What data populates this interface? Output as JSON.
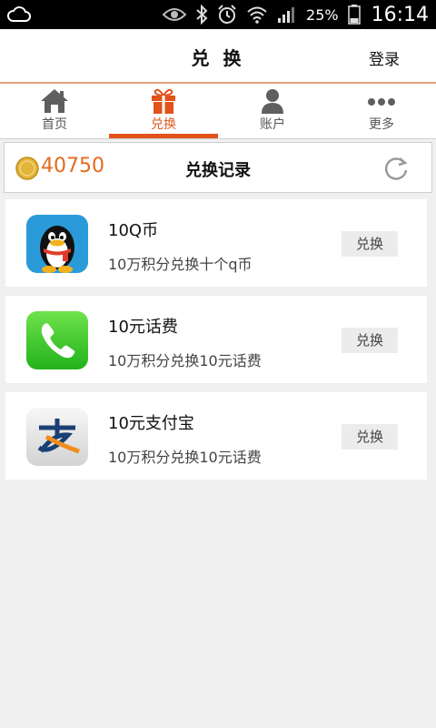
{
  "status_bar": {
    "battery_percent": "25%",
    "time": "16:14",
    "icons": [
      "cloud-icon",
      "eye-icon",
      "bluetooth-icon",
      "alarm-icon",
      "wifi-icon",
      "signal-icon",
      "battery-icon"
    ]
  },
  "header": {
    "title": "兑 换",
    "login_label": "登录"
  },
  "tabs": [
    {
      "label": "首页",
      "icon": "home-icon",
      "active": false
    },
    {
      "label": "兑换",
      "icon": "gift-icon",
      "active": true
    },
    {
      "label": "账户",
      "icon": "user-icon",
      "active": false
    },
    {
      "label": "更多",
      "icon": "more-icon",
      "active": false
    }
  ],
  "points": {
    "value": "40750",
    "records_label": "兑换记录"
  },
  "items": [
    {
      "name": "10Q币",
      "desc": "10万积分兑换十个q币",
      "button": "兑换",
      "icon": "qq-penguin-icon"
    },
    {
      "name": "10元话费",
      "desc": "10万积分兑换10元话费",
      "button": "兑换",
      "icon": "phone-icon"
    },
    {
      "name": "10元支付宝",
      "desc": "10万积分兑换10元话费",
      "button": "兑换",
      "icon": "alipay-icon"
    }
  ],
  "colors": {
    "accent": "#e2521b",
    "points": "#e46b1e",
    "page_bg": "#f0f0f0"
  }
}
